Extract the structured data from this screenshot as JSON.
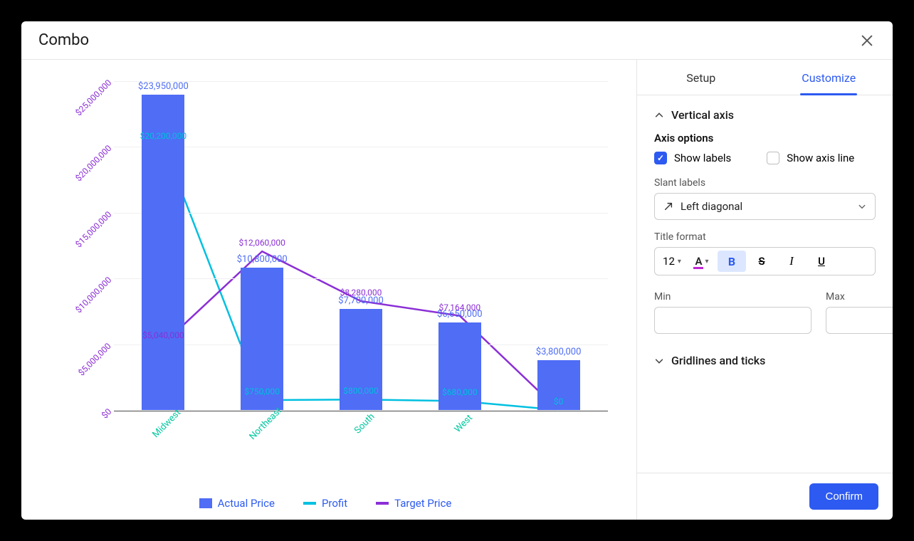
{
  "modal": {
    "title": "Combo"
  },
  "tabs": {
    "setup": "Setup",
    "customize": "Customize"
  },
  "panel": {
    "vertical_axis_header": "Vertical axis",
    "axis_options_label": "Axis options",
    "show_labels_label": "Show labels",
    "show_axis_line_label": "Show axis line",
    "slant_labels_label": "Slant labels",
    "slant_value": "Left diagonal",
    "title_format_label": "Title format",
    "font_size_value": "12",
    "min_label": "Min",
    "max_label": "Max",
    "min_value": "",
    "max_value": "",
    "gridlines_header": "Gridlines and ticks",
    "confirm_label": "Confirm"
  },
  "legend": {
    "actual": "Actual Price",
    "profit": "Profit",
    "target": "Target Price"
  },
  "chart_data": {
    "type": "bar",
    "title": "",
    "xlabel": "",
    "ylabel": "",
    "ylim": [
      0,
      25000000
    ],
    "yticks": [
      "$0",
      "$5,000,000",
      "$10,000,000",
      "$15,000,000",
      "$20,000,000",
      "$25,000,000"
    ],
    "categories": [
      "Midwest",
      "Northeast",
      "South",
      "West",
      ""
    ],
    "series": [
      {
        "name": "Actual Price",
        "kind": "bar",
        "color": "#4f6df5",
        "values": [
          23950000,
          10800000,
          7700000,
          6650000,
          3800000
        ],
        "labels": [
          "$23,950,000",
          "$10,800,000",
          "$7,700,000",
          "$6,650,000",
          "$3,800,000"
        ]
      },
      {
        "name": "Profit",
        "kind": "line",
        "color": "#00c0e0",
        "values": [
          20200000,
          750000,
          800000,
          680000,
          0
        ],
        "labels": [
          "$20,200,000",
          "$750,000",
          "$800,000",
          "$680,000",
          "$0"
        ]
      },
      {
        "name": "Target Price",
        "kind": "line",
        "color": "#8b2fd6",
        "values": [
          5040000,
          12060000,
          8280000,
          7164000,
          0
        ],
        "labels": [
          "$5,040,000",
          "$12,060,000",
          "$8,280,000",
          "$7,164,000",
          ""
        ]
      }
    ]
  }
}
